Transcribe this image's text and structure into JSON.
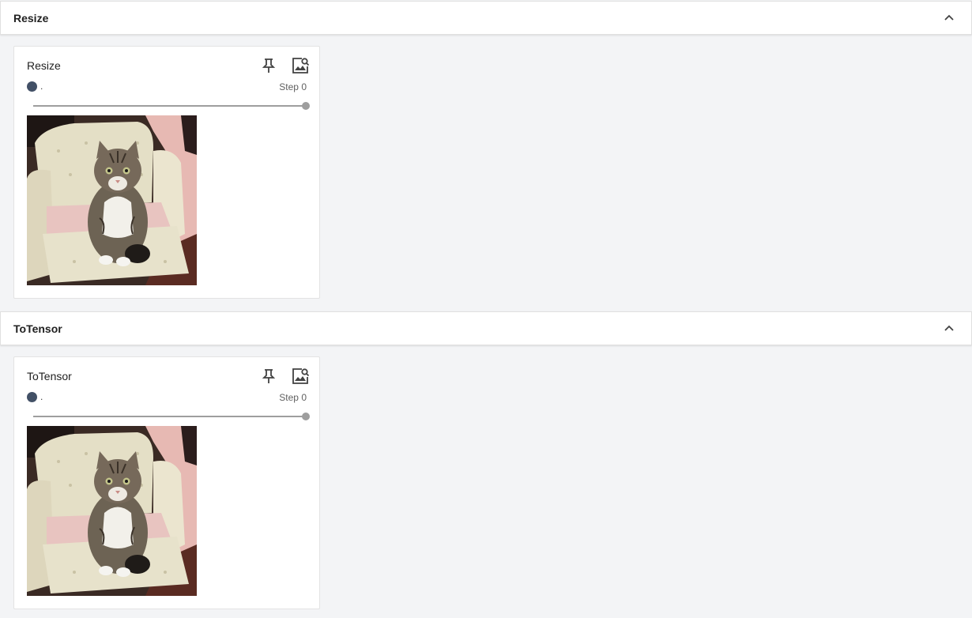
{
  "sections": [
    {
      "title": "Resize",
      "card": {
        "title": "Resize",
        "run_name": ".",
        "step_label": "Step 0",
        "run_color": "#425066",
        "slider_fraction": 1.0
      }
    },
    {
      "title": "ToTensor",
      "card": {
        "title": "ToTensor",
        "run_name": ".",
        "step_label": "Step 0",
        "run_color": "#425066",
        "slider_fraction": 1.0
      }
    }
  ],
  "icons": {
    "collapse": "chevron-up-icon",
    "pin": "pin-icon",
    "image_search": "image-search-icon"
  },
  "colors": {
    "background": "#f3f4f6",
    "run_dot": "#425066",
    "slider": "#9e9e9e"
  }
}
